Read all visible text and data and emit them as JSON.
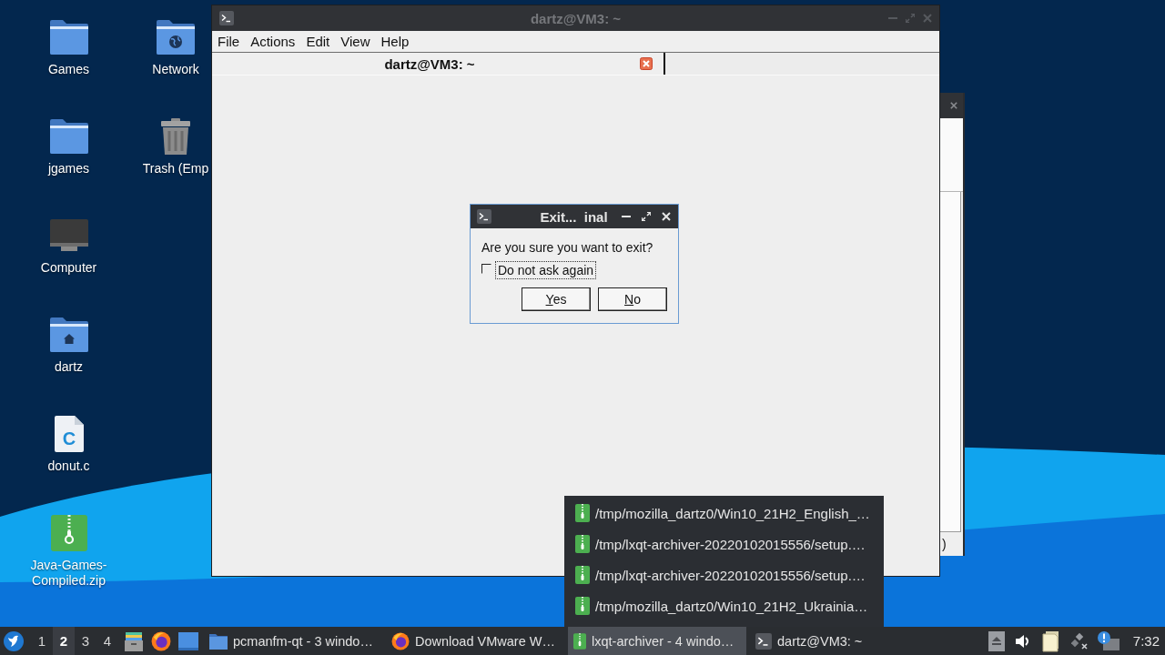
{
  "desktop_icons": [
    {
      "label": "Games",
      "kind": "folder"
    },
    {
      "label": "jgames",
      "kind": "folder"
    },
    {
      "label": "Computer",
      "kind": "computer"
    },
    {
      "label": "dartz",
      "kind": "home"
    },
    {
      "label": "donut.c",
      "kind": "c-file",
      "icon_text": "C"
    },
    {
      "label": "Java-Games-Compiled.zip",
      "kind": "zip"
    },
    {
      "label": "Network",
      "kind": "network"
    },
    {
      "label": "Trash (Emp",
      "kind": "trash"
    }
  ],
  "background_window": {
    "text_fragment": ")"
  },
  "terminal_window": {
    "title": "dartz@VM3: ~",
    "active": false,
    "menu": [
      "File",
      "Actions",
      "Edit",
      "View",
      "Help"
    ],
    "tabs": [
      {
        "label": "dartz@VM3: ~",
        "selected": true
      }
    ]
  },
  "dialog": {
    "title": "Exit...  inal",
    "active": true,
    "message": "Are you sure you want to exit?",
    "checkbox": {
      "label": "Do not ask again",
      "checked": false,
      "focused": true
    },
    "buttons": [
      "Yes",
      "No"
    ]
  },
  "archive_popup": {
    "items": [
      "/tmp/mozilla_dartz0/Win10_21H2_English_…",
      "/tmp/lxqt-archiver-20220102015556/setup.…",
      "/tmp/lxqt-archiver-20220102015556/setup.…",
      "/tmp/mozilla_dartz0/Win10_21H2_Ukrainia…"
    ]
  },
  "taskbar": {
    "desktops": [
      {
        "label": "1",
        "selected": false
      },
      {
        "label": "2",
        "selected": true
      },
      {
        "label": "3",
        "selected": false
      },
      {
        "label": "4",
        "selected": false
      }
    ],
    "tasks": [
      {
        "label": "pcmanfm-qt - 3 windo…",
        "kind": "folder",
        "selected": false
      },
      {
        "label": "Download VMware W…",
        "kind": "browser",
        "selected": false
      },
      {
        "label": "lxqt-archiver - 4 windo…",
        "kind": "archive",
        "selected": true
      },
      {
        "label": "dartz@VM3: ~",
        "kind": "terminal",
        "selected": false
      }
    ],
    "clock": "7:32"
  }
}
